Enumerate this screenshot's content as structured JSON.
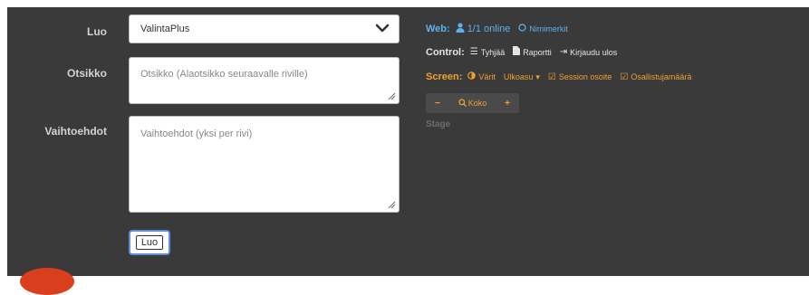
{
  "form": {
    "luo_label": "Luo",
    "select_value": "ValintaPlus",
    "title_label": "Otsikko",
    "title_placeholder": "Otsikko (Alaotsikko seuraavalle riville)",
    "options_label": "Vaihtoehdot",
    "options_placeholder": "Vaihtoehdot (yksi per rivi)",
    "submit_label": "Luo"
  },
  "web": {
    "label": "Web:",
    "online": "1/1 online",
    "names": "Nimimerkit"
  },
  "control": {
    "label": "Control:",
    "clear": "Tyhjää",
    "report": "Raportti",
    "logout": "Kirjaudu ulos"
  },
  "screen": {
    "label": "Screen:",
    "colors": "Värit",
    "layout": "Ulkoasu",
    "session_address": "Session osoite",
    "participants": "Osallistujamäärä"
  },
  "zoom": {
    "minus": "−",
    "label": "Koko",
    "plus": "+"
  },
  "stage": "Stage",
  "colors": {
    "panel_bg": "#3a3a3a",
    "web_blue": "#5eb0ee",
    "screen_orange": "#f0a030",
    "focus_blue": "#5b8fd8"
  }
}
